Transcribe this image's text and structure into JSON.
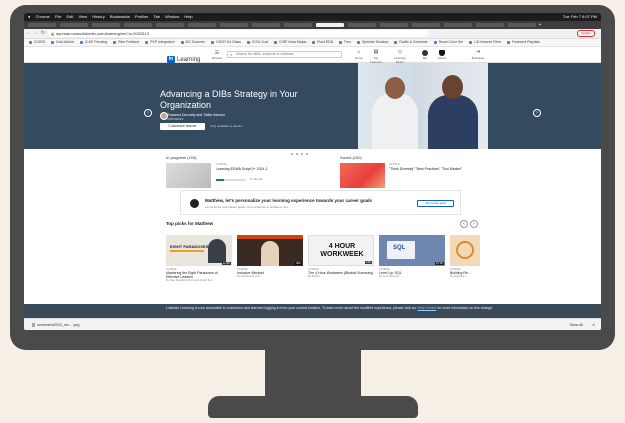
{
  "menu_bar": {
    "items": [
      "Chrome",
      "File",
      "Edit",
      "View",
      "History",
      "Bookmarks",
      "Profiles",
      "Tab",
      "Window",
      "Help"
    ],
    "clock": "Tue Feb 7 6:07 PM"
  },
  "address": {
    "url": "ayumaru.www.linkedin.com/learning/me?u=2033313"
  },
  "browser": {
    "update_label": "Update"
  },
  "bookmarks": [
    "ICOEB",
    "Gold Airbnb",
    "ICAP Pending",
    "Rise Portland",
    "PVP Integration",
    "MC Scanner",
    "OSVR Ed Glass",
    "ICSA Cust",
    "ICBP Insta Mapia",
    "Roof EDB",
    "Treo",
    "Sprinkle Desktop",
    "Drafts & Schedule",
    "Rosel Color Sel",
    "L/D Intranet Fiber",
    "Featured Playlists"
  ],
  "ll_header": {
    "logo_text": "Learning",
    "browse_label": "Browse",
    "search_placeholder": "Search for skills, subjects or software",
    "nav": [
      {
        "label": "Home",
        "glyph": "⌂"
      },
      {
        "label": "My Learning",
        "glyph": "▤"
      },
      {
        "label": "Learning library",
        "glyph": "▭"
      },
      {
        "label": "Me",
        "glyph": ""
      },
      {
        "label": "Admin",
        "glyph": ""
      },
      {
        "label": "Business",
        "glyph": "⇥"
      }
    ]
  },
  "hero": {
    "title": "Advancing a DIBs Strategy in Your Organization",
    "authors": "Rosanna Durruthy and Twiila Hanson",
    "authors_sub": "Instructors",
    "button_label": "Customize learner",
    "note": "Only available to admins",
    "slides_total": 5,
    "slide_active": 0
  },
  "in_progress": {
    "label": "In progress (153)",
    "kind": "COURSE",
    "title": "Learning EDWA Script 0+ 2024-1",
    "progress_text": "1h 14m left",
    "progress": 0.25
  },
  "saved": {
    "label": "Saved (150)",
    "kind": "ARTICLE",
    "title": "\"Think Diversity\" \"Best Practices\" \"Tool Market\""
  },
  "personal": {
    "title": "Matthew, let's personalize your learning experience towards your career goals",
    "subtitle": "Let us know your career goals. Your response is private to you.",
    "button_label": "Set career goal"
  },
  "top_picks": {
    "title": "Top picks for Matthew",
    "items": [
      {
        "kind": "COURSE",
        "title": "Mastering the Eight Paradoxes of Effective Leaders",
        "by": "By Allan Mansfield, Ph.D. and Robert Kurt",
        "duration": "1h 9m",
        "thumb_text": "EIGHT PARADOXES",
        "thumb_bg": "#e9e4dc",
        "accent": "#f0a020"
      },
      {
        "kind": "COURSE",
        "title": "Inclusive Mindset",
        "by": "By Latasha Arts Glov",
        "duration": "38m",
        "thumb_text": "",
        "thumb_bg": "#3b2a24",
        "accent": "#d04010"
      },
      {
        "kind": "COURSE",
        "title": "The 4-Hour Workweek (Blinkist Summary)",
        "by": "By Blinkist",
        "duration": "14m",
        "thumb_text": "4 HOUR WORKWEEK",
        "thumb_bg": "#f2f2f2",
        "accent": "#111111"
      },
      {
        "kind": "COURSE",
        "title": "Level Up: SQL",
        "by": "By Scott Simpson",
        "duration": "1h 4m",
        "thumb_text": "SQL",
        "thumb_bg": "#6f86b0",
        "accent": "#ffffff"
      },
      {
        "kind": "COURSE",
        "title": "Building Re...",
        "by": "By Stephanie...",
        "duration": "",
        "thumb_text": "",
        "thumb_bg": "#f3d9b8",
        "accent": "#e08a2a"
      }
    ]
  },
  "notice": {
    "text": "LinkedIn Learning is now accessible to customers and learners logging in from your current location. To learn more about the modified experience, please visit our",
    "link": "Help Center",
    "tail": "for more information on this change."
  },
  "download_shelf": {
    "file": "screenshot2023_nm... .png",
    "show_all": "Show All"
  },
  "colors": {
    "linkedin_blue": "#0a66c2",
    "hero_bg": "#344a5e",
    "monitor": "#4a4a4a",
    "background": "#f5efe6"
  }
}
